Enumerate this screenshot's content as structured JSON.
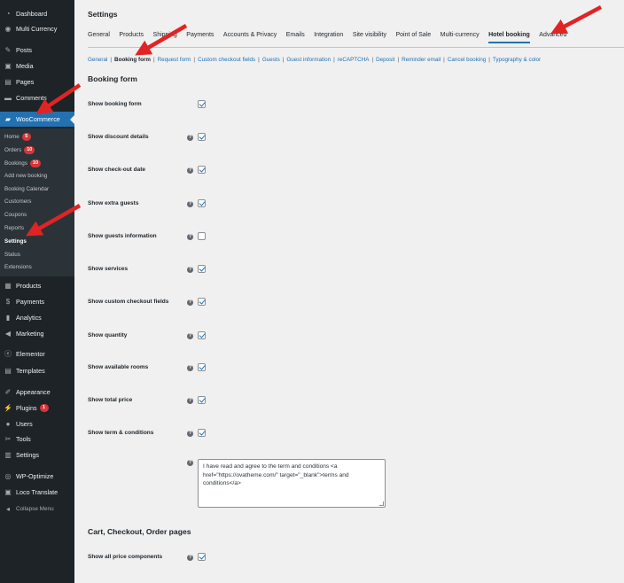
{
  "sidebar": {
    "top_items": [
      {
        "label": "Dashboard",
        "icon": "dashboard-icon"
      },
      {
        "label": "Multi Currency",
        "icon": "currency-icon"
      },
      {
        "label": "Posts",
        "icon": "pin-icon"
      },
      {
        "label": "Media",
        "icon": "media-icon"
      },
      {
        "label": "Pages",
        "icon": "pages-icon"
      },
      {
        "label": "Comments",
        "icon": "comments-icon"
      },
      {
        "label": "WooCommerce",
        "icon": "woocommerce-icon"
      }
    ],
    "submenu": [
      {
        "label": "Home",
        "count": "5"
      },
      {
        "label": "Orders",
        "count": "10"
      },
      {
        "label": "Bookings",
        "count": "10"
      },
      {
        "label": "Add new booking"
      },
      {
        "label": "Booking Calendar"
      },
      {
        "label": "Customers"
      },
      {
        "label": "Coupons"
      },
      {
        "label": "Reports"
      },
      {
        "label": "Settings"
      },
      {
        "label": "Status"
      },
      {
        "label": "Extensions"
      }
    ],
    "bottom_items": [
      {
        "label": "Products",
        "icon": "products-icon"
      },
      {
        "label": "Payments",
        "icon": "payments-icon"
      },
      {
        "label": "Analytics",
        "icon": "analytics-icon"
      },
      {
        "label": "Marketing",
        "icon": "marketing-icon"
      },
      {
        "label": "Elementor",
        "icon": "elementor-icon"
      },
      {
        "label": "Templates",
        "icon": "templates-icon"
      },
      {
        "label": "Appearance",
        "icon": "appearance-icon"
      },
      {
        "label": "Plugins",
        "icon": "plugins-icon",
        "count": "1"
      },
      {
        "label": "Users",
        "icon": "users-icon"
      },
      {
        "label": "Tools",
        "icon": "tools-icon"
      },
      {
        "label": "Settings",
        "icon": "settings-icon"
      },
      {
        "label": "WP-Optimize",
        "icon": "wp-optimize-icon"
      },
      {
        "label": "Loco Translate",
        "icon": "translate-icon"
      },
      {
        "label": "Collapse Menu",
        "icon": "collapse-icon"
      }
    ]
  },
  "page": {
    "title": "Settings",
    "tabs": [
      "General",
      "Products",
      "Shipping",
      "Payments",
      "Accounts & Privacy",
      "Emails",
      "Integration",
      "Site visibility",
      "Point of Sale",
      "Multi-currency",
      "Hotel booking",
      "Advanced"
    ],
    "active_tab": "Hotel booking",
    "subsections": [
      "General",
      "Booking form",
      "Request form",
      "Custom checkout fields",
      "Guests",
      "Guest information",
      "reCAPTCHA",
      "Deposit",
      "Reminder email",
      "Cancel booking",
      "Typography & color"
    ],
    "active_subsection": "Booking form"
  },
  "booking_form": {
    "heading": "Booking form",
    "options": [
      {
        "label": "Show booking form",
        "checked": true,
        "help": false
      },
      {
        "label": "Show discount details",
        "checked": true,
        "help": true
      },
      {
        "label": "Show check-out date",
        "checked": true,
        "help": true
      },
      {
        "label": "Show extra guests",
        "checked": true,
        "help": true
      },
      {
        "label": "Show guests information",
        "checked": false,
        "help": true
      },
      {
        "label": "Show services",
        "checked": true,
        "help": true
      },
      {
        "label": "Show custom checkout fields",
        "checked": true,
        "help": true
      },
      {
        "label": "Show quantity",
        "checked": true,
        "help": true
      },
      {
        "label": "Show available rooms",
        "checked": true,
        "help": true
      },
      {
        "label": "Show total price",
        "checked": true,
        "help": true
      },
      {
        "label": "Show term & conditions",
        "checked": true,
        "help": true
      }
    ],
    "terms_text": "I have read and agree to the term and conditions <a href=\"https://ovatheme.com/\" target=\"_blank\">terms and conditions</a>"
  },
  "cart_section": {
    "heading": "Cart, Checkout, Order pages",
    "options": [
      {
        "label": "Show all price components",
        "checked": true,
        "help": true
      }
    ]
  },
  "colors": {
    "sidebar_bg": "#1d2327",
    "submenu_bg": "#2c3338",
    "accent": "#2271b1",
    "badge": "#d63638",
    "arrow": "#e02424"
  }
}
